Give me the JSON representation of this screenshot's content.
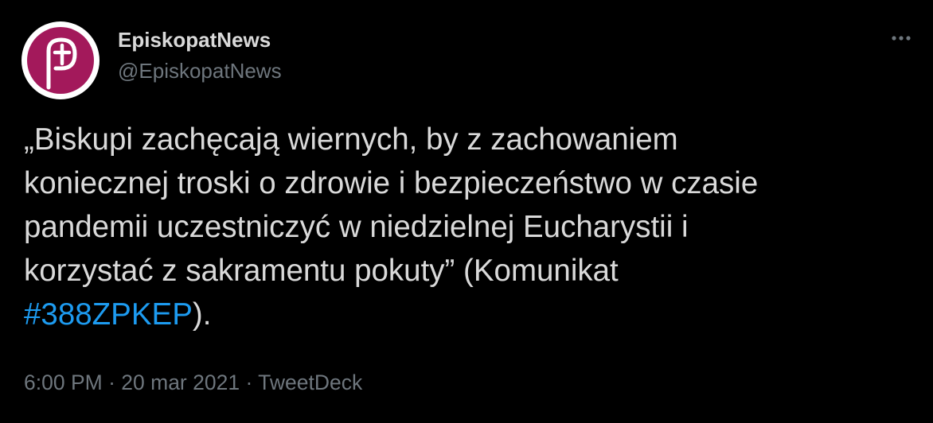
{
  "colors": {
    "background": "#000000",
    "text": "#d9d9d9",
    "secondary_text": "#6e767d",
    "link": "#1d9bf0",
    "avatar_brand": "#a3195b"
  },
  "author": {
    "display_name": "EpiskopatNews",
    "handle": "@EpiskopatNews",
    "avatar_icon": "episkopat-cross-logo"
  },
  "more_icon": "more-horizontal-icon",
  "tweet": {
    "lines": [
      "„Biskupi zachęcają wiernych, by z zachowaniem",
      "koniecznej troski o zdrowie i bezpieczeństwo w czasie",
      "pandemii uczestniczyć w niedzielnej Eucharystii i",
      "korzystać z sakramentu pokuty” (Komunikat"
    ],
    "hashtag": "#388ZPKEP",
    "after_hashtag": ")."
  },
  "meta": {
    "time": "6:00 PM",
    "separator": "·",
    "date": "20 mar 2021",
    "source": "TweetDeck"
  }
}
